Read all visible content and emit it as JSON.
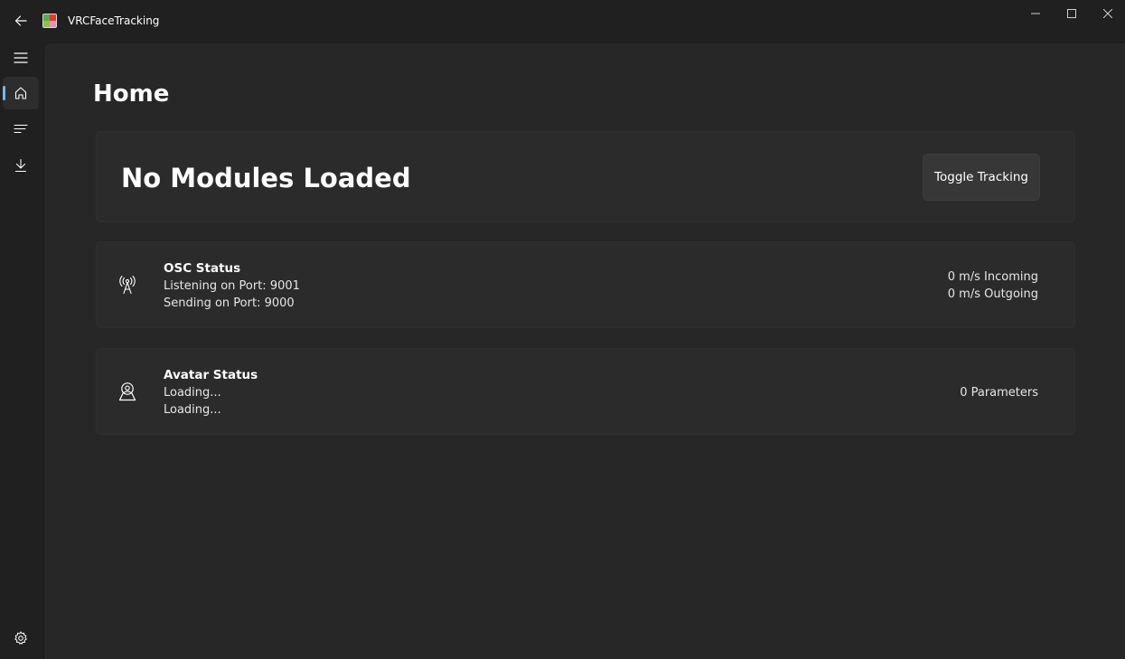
{
  "titlebar": {
    "app_title": "VRCFaceTracking"
  },
  "nav": {
    "items": [
      {
        "name": "menu",
        "icon": "hamburger-menu-icon"
      },
      {
        "name": "home",
        "icon": "home-icon",
        "selected": true
      },
      {
        "name": "output",
        "icon": "list-icon"
      },
      {
        "name": "download",
        "icon": "download-icon"
      },
      {
        "name": "settings",
        "icon": "gear-icon"
      }
    ],
    "accent": "#76b9ed"
  },
  "page": {
    "title": "Home"
  },
  "modules_card": {
    "title": "No Modules Loaded",
    "toggle_label": "Toggle Tracking"
  },
  "osc_card": {
    "icon": "antenna-icon",
    "heading": "OSC Status",
    "listening_label": "Listening on Port:",
    "listening_port": "9001",
    "sending_label": "Sending on Port:",
    "sending_port": "9000",
    "incoming": "0 m/s Incoming",
    "outgoing": "0 m/s Outgoing"
  },
  "avatar_card": {
    "icon": "avatar-icon",
    "heading": "Avatar Status",
    "line1": "Loading...",
    "line2": "Loading...",
    "parameters": "0 Parameters"
  }
}
